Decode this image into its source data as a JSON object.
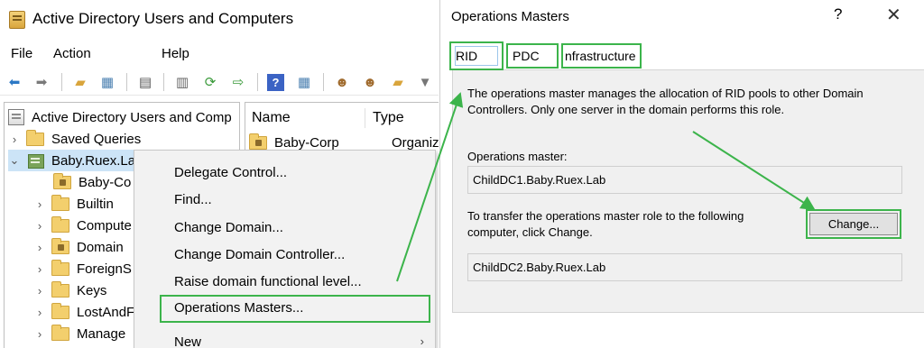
{
  "aduc": {
    "title": "Active Directory Users and Computers",
    "menu": [
      "File",
      "Action",
      "Help"
    ],
    "toolbar_icons": [
      "back-arrow-icon",
      "forward-arrow-icon",
      "up-folder-icon",
      "show-tree-icon",
      "clipboard-icon",
      "properties-icon",
      "refresh-icon",
      "export-icon",
      "help-icon",
      "console-icon",
      "new-user-icon",
      "new-group-icon",
      "new-ou-icon",
      "filter-icon"
    ],
    "tree": {
      "root": "Active Directory Users and Comp",
      "items": [
        {
          "label": "Saved Queries"
        },
        {
          "label": "Baby.Ruex.La"
        },
        {
          "label": "Baby-Co"
        },
        {
          "label": "Builtin"
        },
        {
          "label": "Compute"
        },
        {
          "label": "Domain"
        },
        {
          "label": "ForeignS"
        },
        {
          "label": "Keys"
        },
        {
          "label": "LostAndF"
        },
        {
          "label": "Manage"
        }
      ]
    },
    "list": {
      "columns": [
        "Name",
        "Type"
      ],
      "rows": [
        {
          "name": "Baby-Corp",
          "type": "Organizati"
        }
      ]
    },
    "context_menu": [
      "Delegate Control...",
      "Find...",
      "Change Domain...",
      "Change Domain Controller...",
      "Raise domain functional level...",
      "Operations Masters...",
      "New"
    ]
  },
  "ops": {
    "title": "Operations Masters",
    "help": "?",
    "tabs": [
      "RID",
      "PDC",
      "nfrastructure"
    ],
    "description": "The operations master manages the allocation of RID pools to other Domain Controllers. Only one server in the domain performs this role.",
    "master_label": "Operations master:",
    "master_value": "ChildDC1.Baby.Ruex.Lab",
    "transfer_text": "To transfer the operations master role to the following computer, click Change.",
    "change_label": "Change...",
    "target_value": "ChildDC2.Baby.Ruex.Lab"
  },
  "colors": {
    "highlight": "#3cb44b",
    "selection": "#cce4f7"
  }
}
